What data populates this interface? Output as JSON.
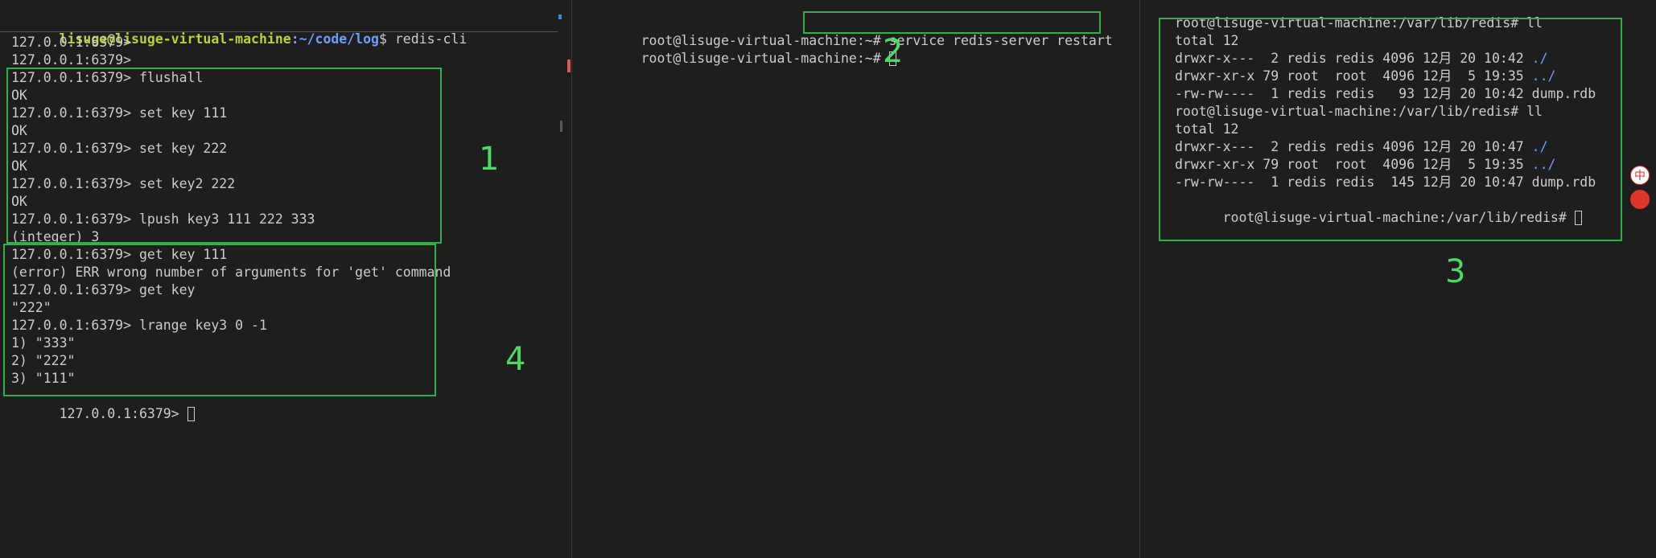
{
  "left": {
    "title": {
      "user": "lisuge@lisuge-virtual-machine",
      "path": ":~/code/log",
      "dollar": "$ ",
      "command": "redis-cli"
    },
    "lines": [
      "127.0.0.1:6379>",
      "127.0.0.1:6379>",
      "127.0.0.1:6379> flushall",
      "OK",
      "127.0.0.1:6379> set key 111",
      "OK",
      "127.0.0.1:6379> set key 222",
      "OK",
      "127.0.0.1:6379> set key2 222",
      "OK",
      "127.0.0.1:6379> lpush key3 111 222 333",
      "(integer) 3",
      "127.0.0.1:6379> get key 111",
      "(error) ERR wrong number of arguments for 'get' command",
      "127.0.0.1:6379> get key",
      "\"222\"",
      "127.0.0.1:6379> lrange key3 0 -1",
      "1) \"333\"",
      "2) \"222\"",
      "3) \"111\""
    ],
    "last_prompt": "127.0.0.1:6379> "
  },
  "middle": {
    "line1_prompt": "root@lisuge-virtual-machine:~# ",
    "line1_command": "service redis-server restart",
    "line2_prompt": "root@lisuge-virtual-machine:~# "
  },
  "right": {
    "lines": [
      {
        "text": "root@lisuge-virtual-machine:/var/lib/redis# ll"
      },
      {
        "text": "total 12"
      },
      {
        "text": "drwxr-x---  2 redis redis 4096 12月 20 10:42 ",
        "dir": "./"
      },
      {
        "text": "drwxr-xr-x 79 root  root  4096 12月  5 19:35 ",
        "dir": "../"
      },
      {
        "text": "-rw-rw----  1 redis redis   93 12月 20 10:42 dump.rdb"
      },
      {
        "text": "root@lisuge-virtual-machine:/var/lib/redis# ll"
      },
      {
        "text": "total 12"
      },
      {
        "text": "drwxr-x---  2 redis redis 4096 12月 20 10:47 ",
        "dir": "./"
      },
      {
        "text": "drwxr-xr-x 79 root  root  4096 12月  5 19:35 ",
        "dir": "../"
      },
      {
        "text": "-rw-rw----  1 redis redis  145 12月 20 10:47 dump.rdb"
      }
    ],
    "last_prompt": "root@lisuge-virtual-machine:/var/lib/redis# "
  },
  "annotations": {
    "n1": "1",
    "n2": "2",
    "n3": "3",
    "n4": "4"
  },
  "ime": {
    "label": "中"
  },
  "colors": {
    "background": "#1e1e1e",
    "text": "#cccccc",
    "box": "#2fb04a",
    "annotation": "#4cd964",
    "prompt_user": "#b5d334",
    "prompt_path": "#6b9eff"
  }
}
